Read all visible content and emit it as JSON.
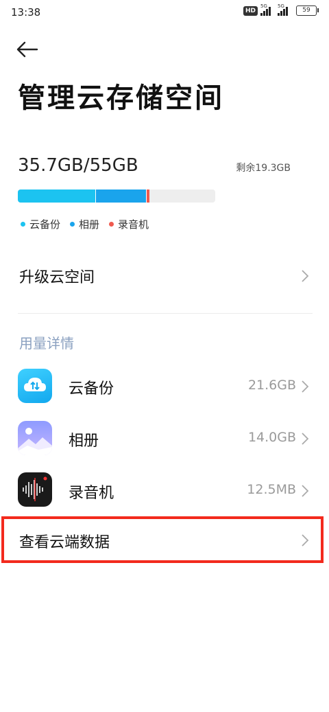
{
  "status_bar": {
    "time": "13:38",
    "hd_label": "HD",
    "network_1": "5G",
    "network_2": "5G",
    "battery": "59"
  },
  "page": {
    "title": "管理云存储空间",
    "back_icon": "arrow-left-icon"
  },
  "storage": {
    "used_total": "35.7GB/55GB",
    "remaining": "剩余19.3GB",
    "segments": [
      {
        "name": "云备份",
        "value_gb": 21.6,
        "color": "#1cc3f0"
      },
      {
        "name": "相册",
        "value_gb": 14.0,
        "color": "#1aa4ec"
      },
      {
        "name": "录音机",
        "value_gb": 0.0125,
        "color": "#ef5a4f"
      }
    ],
    "total_gb": 55
  },
  "legend": [
    {
      "label": "云备份",
      "color": "#1cc3f0"
    },
    {
      "label": "相册",
      "color": "#1aa4ec"
    },
    {
      "label": "录音机",
      "color": "#ef5a4f"
    }
  ],
  "upgrade": {
    "label": "升级云空间"
  },
  "usage_section": {
    "header": "用量详情",
    "items": [
      {
        "name": "云备份",
        "size": "21.6GB",
        "icon": "cloud-backup-icon"
      },
      {
        "name": "相册",
        "size": "14.0GB",
        "icon": "gallery-icon"
      },
      {
        "name": "录音机",
        "size": "12.5MB",
        "icon": "recorder-icon"
      }
    ]
  },
  "view_cloud": {
    "label": "查看云端数据"
  }
}
